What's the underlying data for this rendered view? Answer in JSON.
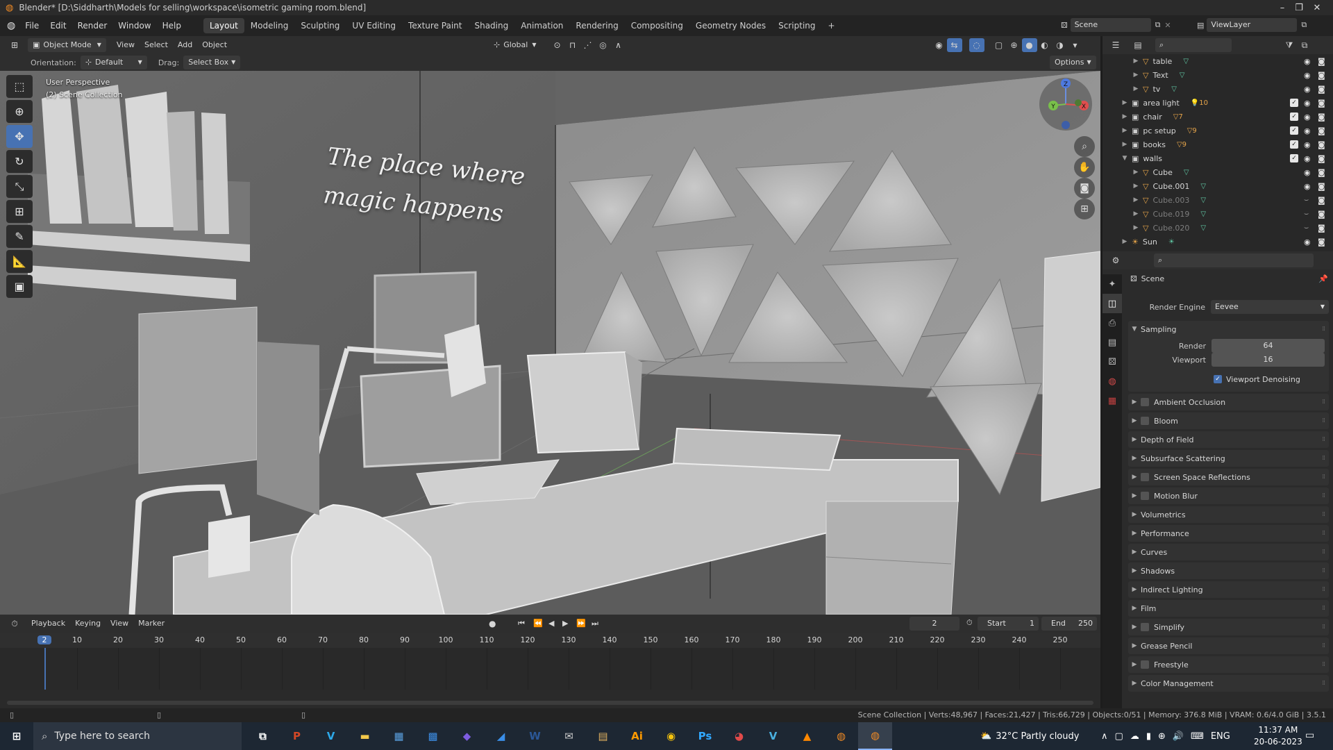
{
  "window": {
    "title": "Blender* [D:\\Siddharth\\Models for selling\\workspace\\isometric gaming room.blend]",
    "minimize": "–",
    "maximize": "❐",
    "close": "✕"
  },
  "menus": [
    "File",
    "Edit",
    "Render",
    "Window",
    "Help"
  ],
  "workspaces": [
    "Layout",
    "Modeling",
    "Sculpting",
    "UV Editing",
    "Texture Paint",
    "Shading",
    "Animation",
    "Rendering",
    "Compositing",
    "Geometry Nodes",
    "Scripting",
    "+"
  ],
  "active_workspace": "Layout",
  "scene_field": "Scene",
  "viewlayer_field": "ViewLayer",
  "viewport_header": {
    "mode": "Object Mode",
    "menus": [
      "View",
      "Select",
      "Add",
      "Object"
    ],
    "transform": "Global",
    "options": "Options"
  },
  "viewport_sub": {
    "orientation_label": "Orientation:",
    "orientation_value": "Default",
    "drag_label": "Drag:",
    "drag_value": "Select Box"
  },
  "viewport_info": {
    "line1": "User Perspective",
    "line2": "(2) Scene Collection"
  },
  "scene_text": {
    "line1": "The place where",
    "line2": "magic happens"
  },
  "gizmo": {
    "z": "Z",
    "y": "Y",
    "x": "X"
  },
  "outliner_rows": [
    {
      "label": "table",
      "indent": 2,
      "icon": "▽",
      "icon_color": "#e8a64a",
      "badge": "▽",
      "badge_color": "#61c7a4",
      "check": false,
      "dim": false
    },
    {
      "label": "Text",
      "indent": 2,
      "icon": "▽",
      "icon_color": "#e8a64a",
      "badge": "▽",
      "badge_color": "#61c7a4",
      "check": false,
      "dim": false
    },
    {
      "label": "tv",
      "indent": 2,
      "icon": "▽",
      "icon_color": "#e8a64a",
      "badge": "▽",
      "badge_color": "#61c7a4",
      "check": false,
      "dim": false
    },
    {
      "label": "area light",
      "indent": 1,
      "icon": "▣",
      "icon_color": "#cfcfcf",
      "badge": "💡10",
      "badge_color": "#e8a64a",
      "check": true,
      "dim": false
    },
    {
      "label": "chair",
      "indent": 1,
      "icon": "▣",
      "icon_color": "#cfcfcf",
      "badge": "▽7",
      "badge_color": "#e8a64a",
      "check": true,
      "dim": false
    },
    {
      "label": "pc setup",
      "indent": 1,
      "icon": "▣",
      "icon_color": "#cfcfcf",
      "badge": "▽9",
      "badge_color": "#e8a64a",
      "check": true,
      "dim": false
    },
    {
      "label": "books",
      "indent": 1,
      "icon": "▣",
      "icon_color": "#cfcfcf",
      "badge": "▽9",
      "badge_color": "#e8a64a",
      "check": true,
      "dim": false
    },
    {
      "label": "walls",
      "indent": 1,
      "icon": "▣",
      "icon_color": "#cfcfcf",
      "badge": "",
      "badge_color": "#e8a64a",
      "check": true,
      "dim": false,
      "expanded": true
    },
    {
      "label": "Cube",
      "indent": 2,
      "icon": "▽",
      "icon_color": "#e8a64a",
      "badge": "▽",
      "badge_color": "#61c7a4",
      "check": false,
      "dim": false
    },
    {
      "label": "Cube.001",
      "indent": 2,
      "icon": "▽",
      "icon_color": "#e8a64a",
      "badge": "▽",
      "badge_color": "#61c7a4",
      "check": false,
      "dim": false
    },
    {
      "label": "Cube.003",
      "indent": 2,
      "icon": "▽",
      "icon_color": "#e8a64a",
      "badge": "▽",
      "badge_color": "#61c7a4",
      "check": false,
      "dim": true
    },
    {
      "label": "Cube.019",
      "indent": 2,
      "icon": "▽",
      "icon_color": "#e8a64a",
      "badge": "▽",
      "badge_color": "#61c7a4",
      "check": false,
      "dim": true
    },
    {
      "label": "Cube.020",
      "indent": 2,
      "icon": "▽",
      "icon_color": "#e8a64a",
      "badge": "▽",
      "badge_color": "#61c7a4",
      "check": false,
      "dim": true
    },
    {
      "label": "Sun",
      "indent": 1,
      "icon": "☀",
      "icon_color": "#e8a64a",
      "badge": "☀",
      "badge_color": "#61c7a4",
      "check": false,
      "dim": false
    }
  ],
  "properties": {
    "header": "Scene",
    "render_engine_label": "Render Engine",
    "render_engine_value": "Eevee",
    "sampling": {
      "title": "Sampling",
      "render_label": "Render",
      "render_value": "64",
      "viewport_label": "Viewport",
      "viewport_value": "16",
      "denoise_label": "Viewport Denoising"
    },
    "panels": [
      {
        "label": "Ambient Occlusion",
        "checkbox": true
      },
      {
        "label": "Bloom",
        "checkbox": true
      },
      {
        "label": "Depth of Field",
        "checkbox": false
      },
      {
        "label": "Subsurface Scattering",
        "checkbox": false
      },
      {
        "label": "Screen Space Reflections",
        "checkbox": true
      },
      {
        "label": "Motion Blur",
        "checkbox": true
      },
      {
        "label": "Volumetrics",
        "checkbox": false
      },
      {
        "label": "Performance",
        "checkbox": false
      },
      {
        "label": "Curves",
        "checkbox": false
      },
      {
        "label": "Shadows",
        "checkbox": false
      },
      {
        "label": "Indirect Lighting",
        "checkbox": false
      },
      {
        "label": "Film",
        "checkbox": false
      },
      {
        "label": "Simplify",
        "checkbox": true
      },
      {
        "label": "Grease Pencil",
        "checkbox": false
      },
      {
        "label": "Freestyle",
        "checkbox": true
      },
      {
        "label": "Color Management",
        "checkbox": false
      }
    ]
  },
  "timeline": {
    "menus": [
      "Playback",
      "Keying",
      "View",
      "Marker"
    ],
    "current_frame": "2",
    "start_label": "Start",
    "start_value": "1",
    "end_label": "End",
    "end_value": "250",
    "ticks": [
      "2",
      "10",
      "20",
      "30",
      "40",
      "50",
      "60",
      "70",
      "80",
      "90",
      "100",
      "110",
      "120",
      "130",
      "140",
      "150",
      "160",
      "170",
      "180",
      "190",
      "200",
      "210",
      "220",
      "230",
      "240",
      "250"
    ]
  },
  "statusbar": {
    "text": "Scene Collection | Verts:48,967 | Faces:21,427 | Tris:66,729 | Objects:0/51 | Memory: 376.8 MiB | VRAM: 0.6/4.0 GiB | 3.5.1"
  },
  "taskbar": {
    "search_placeholder": "Type here to search",
    "apps": [
      {
        "name": "task-view-icon",
        "glyph": "⧉",
        "color": "#ffffff"
      },
      {
        "name": "powerpoint-icon",
        "glyph": "P",
        "color": "#d24726"
      },
      {
        "name": "vscode-icon",
        "glyph": "V",
        "color": "#2da8e8"
      },
      {
        "name": "file-explorer-icon",
        "glyph": "▬",
        "color": "#f2c84b"
      },
      {
        "name": "calculator-icon",
        "glyph": "▦",
        "color": "#5aa0e0"
      },
      {
        "name": "store-icon",
        "glyph": "▩",
        "color": "#3c8be0"
      },
      {
        "name": "edge-icon",
        "glyph": "◆",
        "color": "#7d5ce0"
      },
      {
        "name": "onedrive-icon",
        "glyph": "◢",
        "color": "#3a8ee8"
      },
      {
        "name": "word-icon",
        "glyph": "W",
        "color": "#2b5797"
      },
      {
        "name": "mail-icon",
        "glyph": "✉",
        "color": "#cccccc"
      },
      {
        "name": "notes-icon",
        "glyph": "▤",
        "color": "#e0b060"
      },
      {
        "name": "illustrator-icon",
        "glyph": "Ai",
        "color": "#ff9a00"
      },
      {
        "name": "chrome-icon",
        "glyph": "◉",
        "color": "#f4c20d"
      },
      {
        "name": "photoshop-icon",
        "glyph": "Ps",
        "color": "#31a8ff"
      },
      {
        "name": "app-icon",
        "glyph": "◕",
        "color": "#e04a4a"
      },
      {
        "name": "app2-icon",
        "glyph": "V",
        "color": "#4ab0e0"
      },
      {
        "name": "vlc-icon",
        "glyph": "▲",
        "color": "#ff8800"
      },
      {
        "name": "blender-icon",
        "glyph": "◍",
        "color": "#f08a24"
      },
      {
        "name": "blender-active-icon",
        "glyph": "◍",
        "color": "#f08a24"
      }
    ],
    "weather": "32°C  Partly cloudy",
    "language": "ENG",
    "time": "11:37 AM",
    "date": "20-06-2023"
  }
}
